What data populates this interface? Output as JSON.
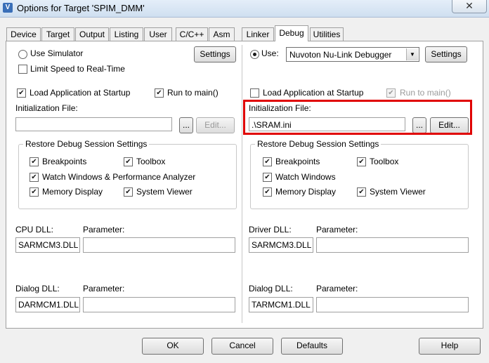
{
  "window": {
    "title": "Options for Target 'SPIM_DMM'",
    "icon_glyph": "V",
    "close_glyph": "✕"
  },
  "tabs": [
    {
      "label": "Device"
    },
    {
      "label": "Target"
    },
    {
      "label": "Output"
    },
    {
      "label": "Listing"
    },
    {
      "label": "User"
    },
    {
      "label": "C/C++"
    },
    {
      "label": "Asm"
    },
    {
      "label": "Linker"
    },
    {
      "label": "Debug",
      "active": true
    },
    {
      "label": "Utilities"
    }
  ],
  "left": {
    "use_simulator": "Use Simulator",
    "limit_speed": "Limit Speed to Real-Time",
    "settings_label": "Settings",
    "load_app": "Load Application at Startup",
    "run_to_main": "Run to main()",
    "init_file_label": "Initialization File:",
    "init_file_value": "",
    "browse_label": "...",
    "edit_label": "Edit...",
    "restore_title": "Restore Debug Session Settings",
    "breakpoints": "Breakpoints",
    "toolbox": "Toolbox",
    "watch_windows": "Watch Windows & Performance Analyzer",
    "memory_display": "Memory Display",
    "system_viewer": "System Viewer",
    "cpu_dll_label": "CPU DLL:",
    "cpu_param_label": "Parameter:",
    "cpu_dll_value": "SARMCM3.DLL",
    "cpu_param_value": "",
    "dialog_dll_label": "Dialog DLL:",
    "dialog_param_label": "Parameter:",
    "dialog_dll_value": "DARMCM1.DLL",
    "dialog_param_value": ""
  },
  "right": {
    "use_label": "Use:",
    "debugger_value": "Nuvoton Nu-Link Debugger",
    "settings_label": "Settings",
    "load_app": "Load Application at Startup",
    "run_to_main": "Run to main()",
    "init_file_label": "Initialization File:",
    "init_file_value": ".\\SRAM.ini",
    "browse_label": "...",
    "edit_label": "Edit...",
    "restore_title": "Restore Debug Session Settings",
    "breakpoints": "Breakpoints",
    "toolbox": "Toolbox",
    "watch_windows": "Watch Windows",
    "memory_display": "Memory Display",
    "system_viewer": "System Viewer",
    "driver_dll_label": "Driver DLL:",
    "driver_param_label": "Parameter:",
    "driver_dll_value": "SARMCM3.DLL",
    "driver_param_value": "",
    "dialog_dll_label": "Dialog DLL:",
    "dialog_param_label": "Parameter:",
    "dialog_dll_value": "TARMCM1.DLL",
    "dialog_param_value": ""
  },
  "footer": {
    "ok": "OK",
    "cancel": "Cancel",
    "defaults": "Defaults",
    "help": "Help"
  },
  "glyphs": {
    "check": "✔",
    "dropdown": "▼"
  },
  "colors": {
    "highlight": "#e00000"
  }
}
